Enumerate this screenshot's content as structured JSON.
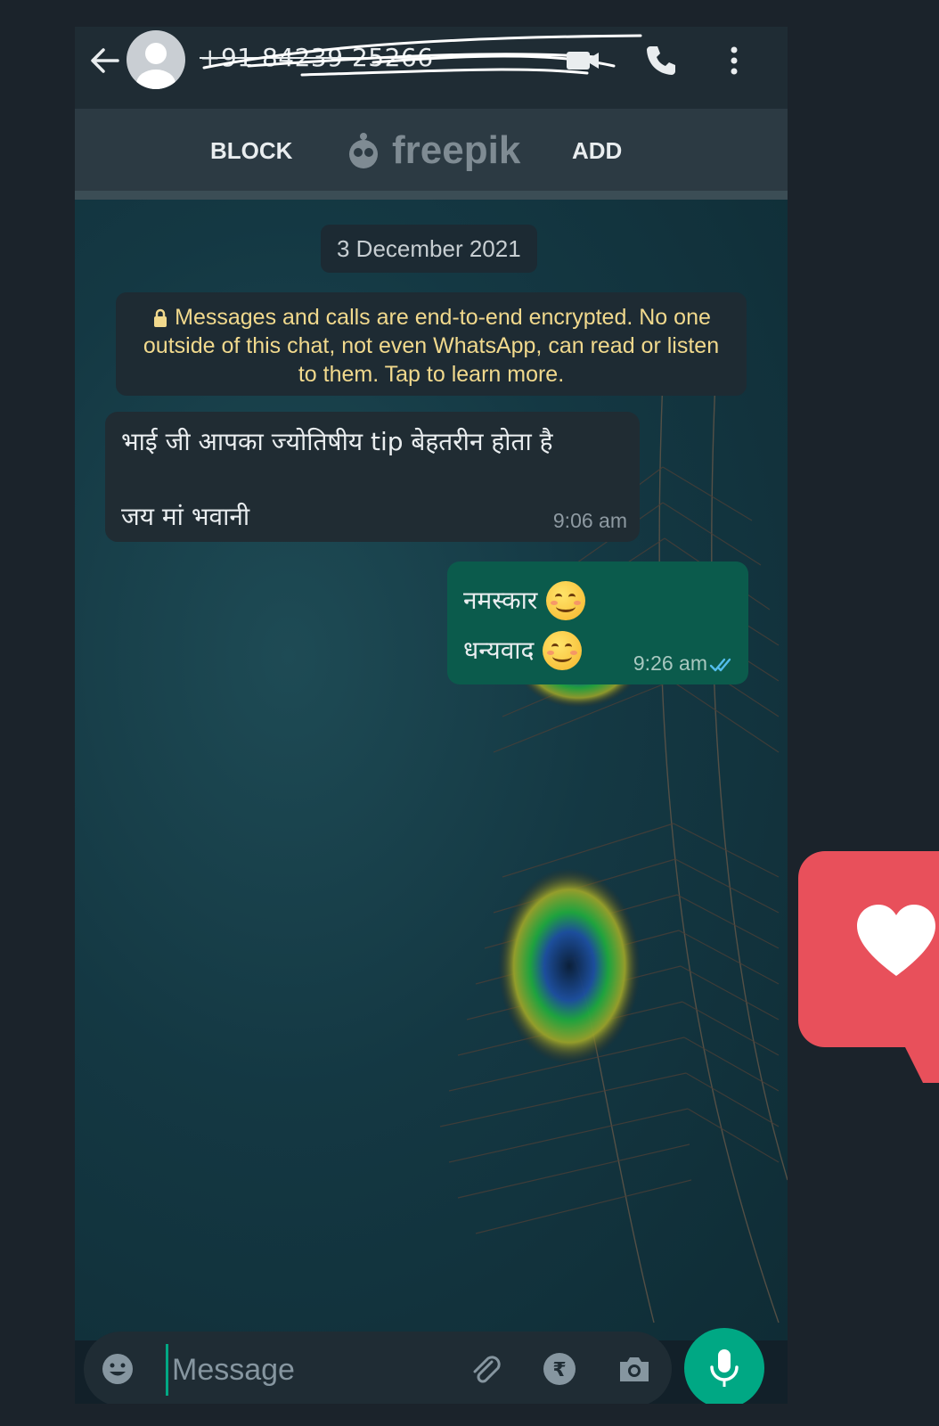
{
  "header": {
    "phone_number": "+91 84239 25266",
    "icons": [
      "back-arrow-icon",
      "avatar",
      "video-call-icon",
      "voice-call-icon",
      "more-options-icon"
    ]
  },
  "spam_bar": {
    "block_label": "BLOCK",
    "add_label": "ADD",
    "watermark_text": "freepik"
  },
  "chat": {
    "date_chip": "3 December 2021",
    "encryption_notice": "Messages and calls are end-to-end encrypted. No one outside of this chat, not even WhatsApp, can read or listen to them. Tap to learn more.",
    "messages": [
      {
        "direction": "incoming",
        "line1": "भाई जी आपका ज्योतिषीय tip बेहतरीन होता है",
        "line2": "जय मां भवानी",
        "time": "9:06 am"
      },
      {
        "direction": "outgoing",
        "line1": "नमस्कार",
        "line2": "धन्यवाद",
        "emoji": "smiling-face",
        "time": "9:26 am",
        "status": "read"
      }
    ]
  },
  "composer": {
    "placeholder": "Message",
    "icons": [
      "emoji-icon",
      "attach-icon",
      "rupee-payment-icon",
      "camera-icon",
      "mic-icon"
    ]
  },
  "colors": {
    "accent": "#00a884",
    "outgoing_bubble": "#0b5b4c",
    "incoming_bubble": "#202c33",
    "notice_text": "#f1d98d",
    "like_badge": "#e8505b"
  }
}
